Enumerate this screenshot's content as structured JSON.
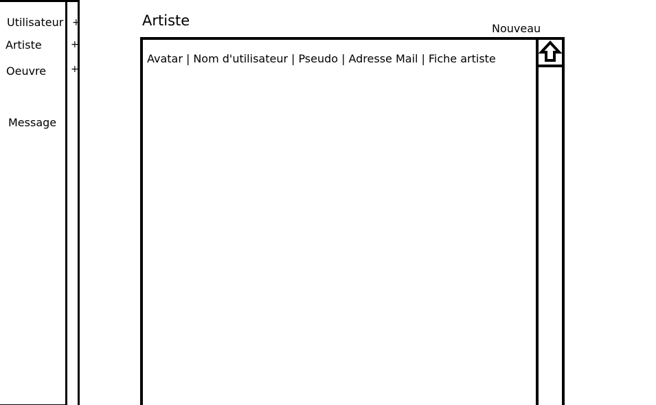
{
  "sidebar": {
    "items": [
      {
        "label": "Utilisateur",
        "plus": "+"
      },
      {
        "label": "Artiste",
        "plus": "+"
      },
      {
        "label": "Oeuvre",
        "plus": "+"
      },
      {
        "label": "Message"
      }
    ]
  },
  "main": {
    "title": "Artiste",
    "new_label": "Nouveau",
    "columns": [
      "Avatar",
      "Nom d'utilisateur",
      "Pseudo",
      "Adresse Mail",
      "Fiche artiste"
    ],
    "separator": "|"
  },
  "icons": {
    "scroll_up": "up-arrow-icon"
  }
}
